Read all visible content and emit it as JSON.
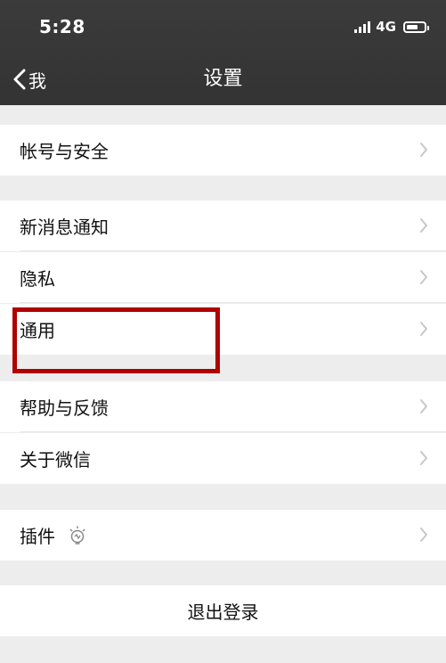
{
  "status_bar": {
    "time": "5:28",
    "network": "4G"
  },
  "nav": {
    "back_label": "我",
    "title": "设置"
  },
  "menu": {
    "account_security": "帐号与安全",
    "new_message_notification": "新消息通知",
    "privacy": "隐私",
    "general": "通用",
    "help_feedback": "帮助与反馈",
    "about_wechat": "关于微信",
    "plugins": "插件"
  },
  "logout": {
    "label": "退出登录"
  },
  "colors": {
    "nav_bg": "#333333",
    "page_bg": "#ededed",
    "highlight": "#b00000"
  }
}
